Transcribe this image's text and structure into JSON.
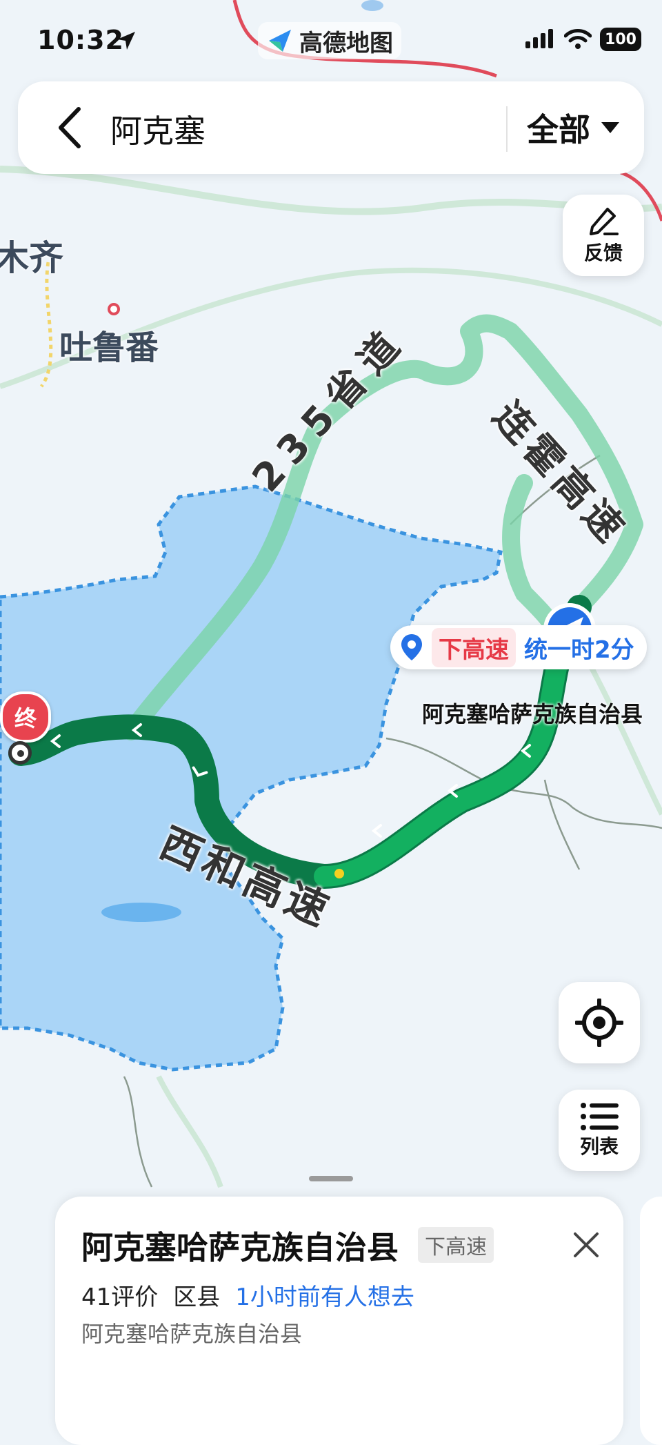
{
  "status_bar": {
    "time": "10:32",
    "battery": "100"
  },
  "app": {
    "brand": "高德地图"
  },
  "search": {
    "query": "阿克塞",
    "filter_label": "全部"
  },
  "controls": {
    "feedback_label": "反馈",
    "list_label": "列表"
  },
  "map": {
    "city_partial": "木齐",
    "city_turpan": "吐鲁番",
    "road_235": "235省道",
    "road_lianhuo": "连霍高速",
    "road_xihe": "西和高速",
    "place_label": "阿克塞哈萨克族自治县",
    "end_marker": "终",
    "route_tip": {
      "tag": "下高速",
      "info": "统一时2分"
    }
  },
  "sheet": {
    "title": "阿克塞哈萨克族自治县",
    "tag": "下高速",
    "reviews": "41评价",
    "category": "区县",
    "hot": "1小时前有人想去",
    "address": "阿克塞哈萨克族自治县"
  },
  "colors": {
    "route_primary": "#13b060",
    "route_dark": "#0b7a48",
    "route_alt": "#7ad3a8",
    "region_fill": "#aad5f7",
    "region_border": "#3a93df",
    "accent_blue": "#2470e6",
    "end_red": "#e8434f"
  }
}
